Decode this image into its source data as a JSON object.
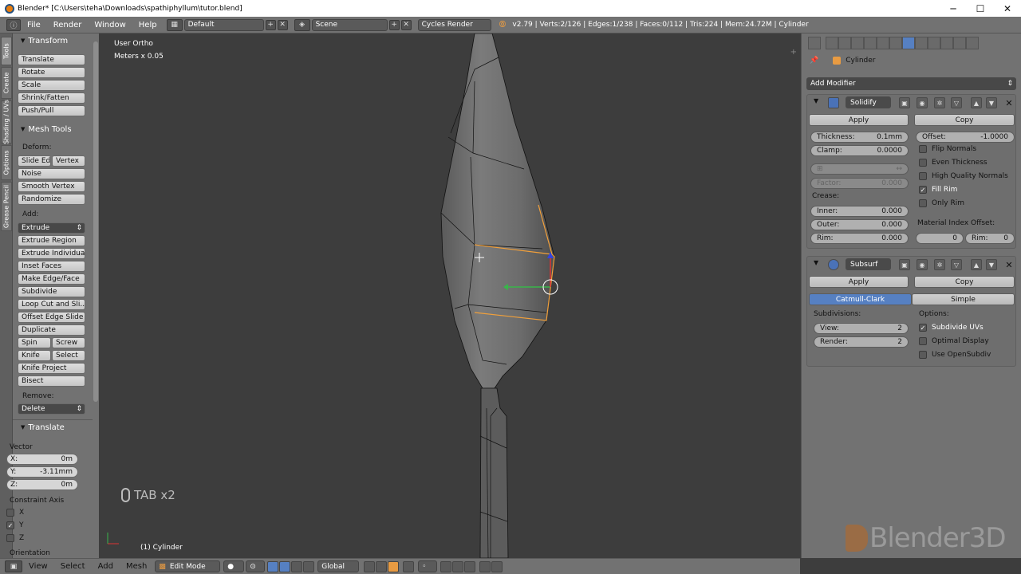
{
  "window": {
    "title": "Blender* [C:\\Users\\teha\\Downloads\\spathiphyllum\\tutor.blend]",
    "min": "─",
    "max": "☐",
    "close": "✕"
  },
  "topbar": {
    "menus": [
      "File",
      "Render",
      "Window",
      "Help"
    ],
    "layout": "Default",
    "scene": "Scene",
    "engine": "Cycles Render",
    "stats": "v2.79 | Verts:2/126 | Edges:1/238 | Faces:0/112 | Tris:224 | Mem:24.72M | Cylinder"
  },
  "lefttabs": [
    "Tools",
    "Create",
    "Shading / UVs",
    "Options",
    "Grease Pencil"
  ],
  "toolshelf": {
    "transform_header": "Transform",
    "transform": [
      "Translate",
      "Rotate",
      "Scale",
      "Shrink/Fatten",
      "Push/Pull"
    ],
    "meshtools_header": "Mesh Tools",
    "deform_label": "Deform:",
    "deform_row": [
      "Slide Ed",
      "Vertex"
    ],
    "deform": [
      "Noise",
      "Smooth Vertex",
      "Randomize"
    ],
    "add_label": "Add:",
    "extrude": "Extrude",
    "add": [
      "Extrude Region",
      "Extrude Individual",
      "Inset Faces",
      "Make Edge/Face",
      "Subdivide",
      "Loop Cut and Sli...",
      "Offset Edge Slide",
      "Duplicate"
    ],
    "row1": [
      "Spin",
      "Screw"
    ],
    "row2": [
      "Knife",
      "Select"
    ],
    "add2": [
      "Knife Project",
      "Bisect"
    ],
    "remove_label": "Remove:",
    "delete": "Delete",
    "translate_header": "Translate",
    "vector_label": "Vector",
    "x": {
      "label": "X:",
      "value": "0m"
    },
    "y": {
      "label": "Y:",
      "value": "-3.11mm"
    },
    "z": {
      "label": "Z:",
      "value": "0m"
    },
    "constraint_label": "Constraint Axis",
    "cx": "X",
    "cy": "Y",
    "cz": "Z",
    "orientation_label": "Orientation"
  },
  "viewport": {
    "view": "User Ortho",
    "units": "Meters x 0.05",
    "object": "(1) Cylinder",
    "keyhint": "TAB x2"
  },
  "bottombar": {
    "menus": [
      "View",
      "Select",
      "Add",
      "Mesh"
    ],
    "mode": "Edit Mode",
    "orientation": "Global"
  },
  "props": {
    "object": "Cylinder",
    "add_modifier": "Add Modifier",
    "solidify": {
      "name": "Solidify",
      "apply": "Apply",
      "copy": "Copy",
      "thickness": {
        "label": "Thickness:",
        "value": "0.1mm"
      },
      "offset": {
        "label": "Offset:",
        "value": "-1.0000"
      },
      "clamp": {
        "label": "Clamp:",
        "value": "0.0000"
      },
      "flip": "Flip Normals",
      "even": "Even Thickness",
      "hq": "High Quality Normals",
      "fillrim": "Fill Rim",
      "onlyrim": "Only Rim",
      "factor": {
        "label": "Factor:",
        "value": "0.000"
      },
      "crease": "Crease:",
      "inner": {
        "label": "Inner:",
        "value": "0.000"
      },
      "outer": {
        "label": "Outer:",
        "value": "0.000"
      },
      "rim": {
        "label": "Rim:",
        "value": "0.000"
      },
      "matidx": "Material Index Offset:",
      "mat0": "0",
      "rimidx": {
        "label": "Rim:",
        "value": "0"
      }
    },
    "subsurf": {
      "name": "Subsurf",
      "apply": "Apply",
      "copy": "Copy",
      "catmull": "Catmull-Clark",
      "simple": "Simple",
      "subdivisions": "Subdivisions:",
      "options": "Options:",
      "view": {
        "label": "View:",
        "value": "2"
      },
      "render": {
        "label": "Render:",
        "value": "2"
      },
      "subuv": "Subdivide UVs",
      "optimal": "Optimal Display",
      "opensubdiv": "Use OpenSubdiv"
    }
  },
  "watermark": "Blender3D",
  "colors": {
    "accent": "#5680c2",
    "edge_select": "#f2a03a"
  }
}
